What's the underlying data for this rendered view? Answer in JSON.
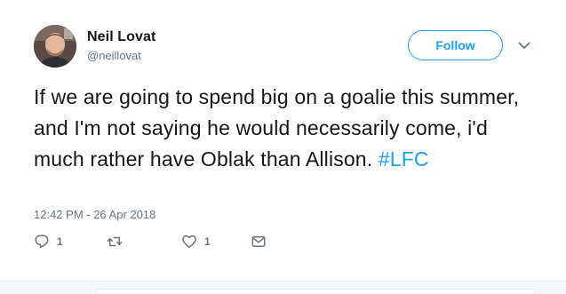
{
  "user": {
    "display_name": "Neil Lovat",
    "handle": "@neillovat"
  },
  "follow_button": {
    "label": "Follow"
  },
  "tweet": {
    "text": "If we are going to spend big on a goalie this summer, and I'm not saying he would necessarily come, i'd much rather have Oblak than Allison.",
    "hashtag": "#LFC",
    "timestamp": "12:42 PM - 26 Apr 2018"
  },
  "actions": {
    "reply_count": "1",
    "retweet_count": "",
    "like_count": "1"
  },
  "colors": {
    "accent": "#1da1f2",
    "text": "#14171a",
    "secondary": "#657786"
  },
  "icons": [
    "avatar",
    "chevron-down-icon",
    "reply-icon",
    "retweet-icon",
    "heart-icon",
    "envelope-icon"
  ]
}
